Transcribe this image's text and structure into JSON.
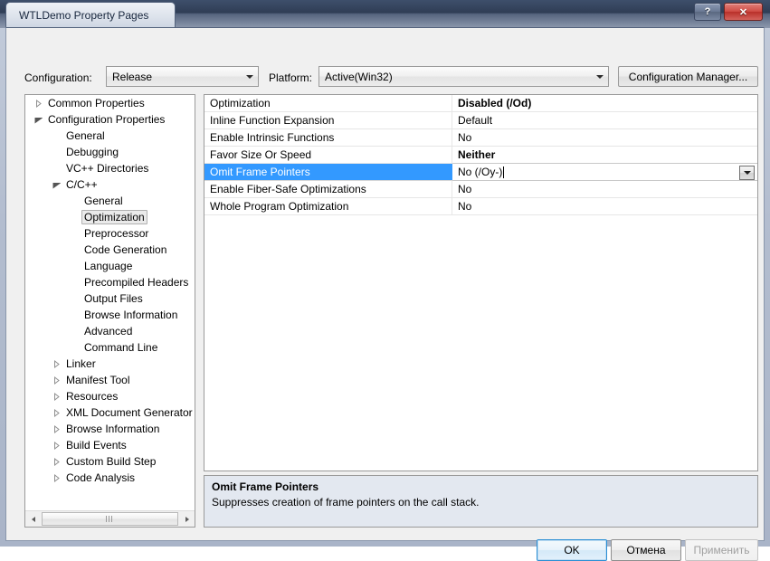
{
  "window": {
    "title": "WTLDemo Property Pages",
    "help_button": "?",
    "close_button": "✕"
  },
  "toolbar": {
    "configuration_label": "Configuration:",
    "configuration_value": "Release",
    "platform_label": "Platform:",
    "platform_value": "Active(Win32)",
    "configuration_manager_label": "Configuration Manager..."
  },
  "tree": {
    "items": [
      {
        "label": "Common Properties",
        "indent": 0,
        "state": "collapsed",
        "selected": false
      },
      {
        "label": "Configuration Properties",
        "indent": 0,
        "state": "expanded",
        "selected": false
      },
      {
        "label": "General",
        "indent": 1,
        "state": "leaf",
        "selected": false
      },
      {
        "label": "Debugging",
        "indent": 1,
        "state": "leaf",
        "selected": false
      },
      {
        "label": "VC++ Directories",
        "indent": 1,
        "state": "leaf",
        "selected": false
      },
      {
        "label": "C/C++",
        "indent": 1,
        "state": "expanded",
        "selected": false
      },
      {
        "label": "General",
        "indent": 2,
        "state": "leaf",
        "selected": false
      },
      {
        "label": "Optimization",
        "indent": 2,
        "state": "leaf",
        "selected": true
      },
      {
        "label": "Preprocessor",
        "indent": 2,
        "state": "leaf",
        "selected": false
      },
      {
        "label": "Code Generation",
        "indent": 2,
        "state": "leaf",
        "selected": false
      },
      {
        "label": "Language",
        "indent": 2,
        "state": "leaf",
        "selected": false
      },
      {
        "label": "Precompiled Headers",
        "indent": 2,
        "state": "leaf",
        "selected": false
      },
      {
        "label": "Output Files",
        "indent": 2,
        "state": "leaf",
        "selected": false
      },
      {
        "label": "Browse Information",
        "indent": 2,
        "state": "leaf",
        "selected": false
      },
      {
        "label": "Advanced",
        "indent": 2,
        "state": "leaf",
        "selected": false
      },
      {
        "label": "Command Line",
        "indent": 2,
        "state": "leaf",
        "selected": false
      },
      {
        "label": "Linker",
        "indent": 1,
        "state": "collapsed",
        "selected": false
      },
      {
        "label": "Manifest Tool",
        "indent": 1,
        "state": "collapsed",
        "selected": false
      },
      {
        "label": "Resources",
        "indent": 1,
        "state": "collapsed",
        "selected": false
      },
      {
        "label": "XML Document Generator",
        "indent": 1,
        "state": "collapsed",
        "selected": false
      },
      {
        "label": "Browse Information",
        "indent": 1,
        "state": "collapsed",
        "selected": false
      },
      {
        "label": "Build Events",
        "indent": 1,
        "state": "collapsed",
        "selected": false
      },
      {
        "label": "Custom Build Step",
        "indent": 1,
        "state": "collapsed",
        "selected": false
      },
      {
        "label": "Code Analysis",
        "indent": 1,
        "state": "collapsed",
        "selected": false
      }
    ]
  },
  "grid": {
    "rows": [
      {
        "name": "Optimization",
        "value": "Disabled (/Od)",
        "bold": true,
        "selected": false,
        "editing": false
      },
      {
        "name": "Inline Function Expansion",
        "value": "Default",
        "bold": false,
        "selected": false,
        "editing": false
      },
      {
        "name": "Enable Intrinsic Functions",
        "value": "No",
        "bold": false,
        "selected": false,
        "editing": false
      },
      {
        "name": "Favor Size Or Speed",
        "value": "Neither",
        "bold": true,
        "selected": false,
        "editing": false
      },
      {
        "name": "Omit Frame Pointers",
        "value": "No (/Oy-)",
        "bold": false,
        "selected": true,
        "editing": true
      },
      {
        "name": "Enable Fiber-Safe Optimizations",
        "value": "No",
        "bold": false,
        "selected": false,
        "editing": false
      },
      {
        "name": "Whole Program Optimization",
        "value": "No",
        "bold": false,
        "selected": false,
        "editing": false
      }
    ]
  },
  "description": {
    "title": "Omit Frame Pointers",
    "body": "Suppresses creation of frame pointers on the call stack."
  },
  "buttons": {
    "ok": "OK",
    "cancel": "Отмена",
    "apply": "Применить"
  },
  "colors": {
    "selection_blue": "#3399ff",
    "titlebar_dark": "#2f3d55",
    "close_red": "#cf4c45",
    "description_bg": "#e3e8f0",
    "default_button_border": "#2c8fd4"
  }
}
